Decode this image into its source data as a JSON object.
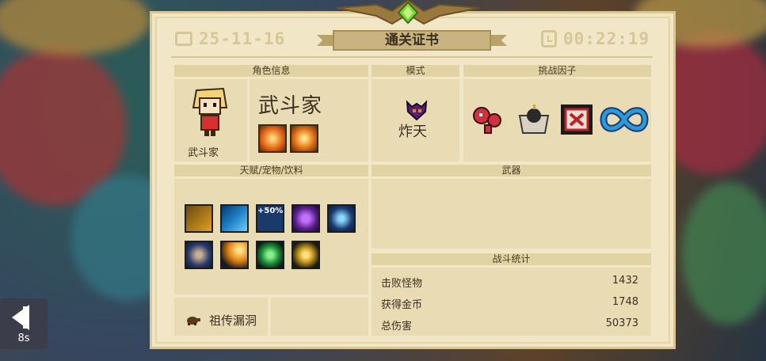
{
  "certificate": {
    "date": "25-11-16",
    "title": "通关证书",
    "time": "00:22:19"
  },
  "sections": {
    "character_info": "角色信息",
    "mode": "模式",
    "challenge_factors": "挑战因子",
    "talents": "天赋/宠物/饮料",
    "weapons": "武器",
    "battle_stats": "战斗统计"
  },
  "character": {
    "class_name": "武斗家",
    "caption": "武斗家",
    "skills": [
      "fist-flame-skill-icon",
      "punch-burst-skill-icon"
    ]
  },
  "mode": {
    "label": "炸天",
    "icon": "demon-skull-icon"
  },
  "challenge_factors": [
    {
      "icon": "red-creature-icon",
      "color": "#d0323c"
    },
    {
      "icon": "bomb-box-icon",
      "color": "#2a2a2a"
    },
    {
      "icon": "red-x-film-icon",
      "color": "#c0202a"
    },
    {
      "icon": "infinity-icon",
      "color": "#2a9ad8"
    }
  ],
  "talents": [
    {
      "icon": "shield-plus-icon",
      "color": "#e0a020"
    },
    {
      "icon": "blue-blade-icon",
      "color": "#1e7fc4"
    },
    {
      "icon": "shield-50-icon",
      "color": "#1a3a6a",
      "text": "+50%"
    },
    {
      "icon": "purple-shield-icon",
      "color": "#5a1e8a"
    },
    {
      "icon": "blue-spear-icon",
      "color": "#1a3a70"
    },
    {
      "icon": "armored-knight-icon",
      "color": "#2a3a6a"
    },
    {
      "icon": "fireball-icon",
      "color": "#e08010"
    },
    {
      "icon": "green-shield-icon",
      "color": "#1a8a3a"
    },
    {
      "icon": "gold-music-icon",
      "color": "#c89a20"
    }
  ],
  "stats": [
    {
      "label": "击败怪物",
      "value": "1432"
    },
    {
      "label": "获得金币",
      "value": "1748"
    },
    {
      "label": "总伤害",
      "value": "50373"
    }
  ],
  "relic": {
    "label": "祖传漏洞",
    "icon": "turtle-icon"
  },
  "back_button": {
    "countdown": "8s"
  }
}
